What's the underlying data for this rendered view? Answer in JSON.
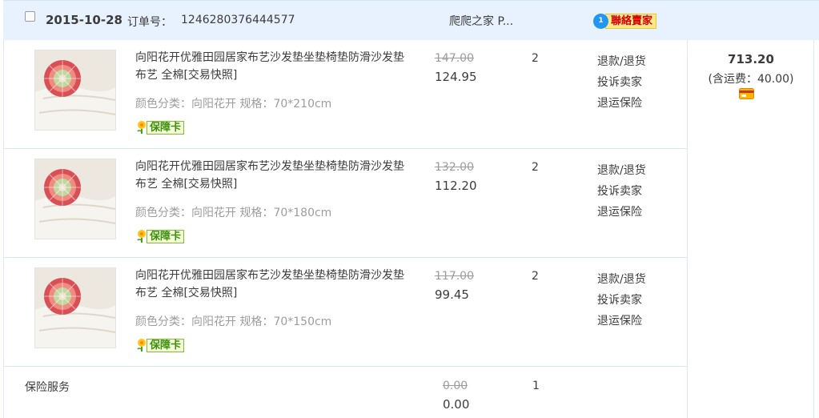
{
  "order": {
    "date": "2015-10-28",
    "order_no_label": "订单号：",
    "order_no": "1246280376444577",
    "shop_name": "爬爬之家 P...",
    "contact_label": "聯絡賣家",
    "contact_badge": "1"
  },
  "items": [
    {
      "title": "向阳花开优雅田园居家布艺沙发垫坐垫椅垫防滑沙发垫 布艺 全棉[交易快照]",
      "sku": "颜色分类：向阳花开  规格：70*210cm",
      "badge": "保障卡",
      "price_original": "147.00",
      "price_now": "124.95",
      "qty": "2",
      "actions": [
        "退款/退货",
        "投诉卖家",
        "退运保险"
      ]
    },
    {
      "title": "向阳花开优雅田园居家布艺沙发垫坐垫椅垫防滑沙发垫 布艺 全棉[交易快照]",
      "sku": "颜色分类：向阳花开  规格：70*180cm",
      "badge": "保障卡",
      "price_original": "132.00",
      "price_now": "112.20",
      "qty": "2",
      "actions": [
        "退款/退货",
        "投诉卖家",
        "退运保险"
      ]
    },
    {
      "title": "向阳花开优雅田园居家布艺沙发垫坐垫椅垫防滑沙发垫 布艺 全棉[交易快照]",
      "sku": "颜色分类：向阳花开  规格：70*150cm",
      "badge": "保障卡",
      "price_original": "117.00",
      "price_now": "99.45",
      "qty": "2",
      "actions": [
        "退款/退货",
        "投诉卖家",
        "退运保险"
      ]
    }
  ],
  "insurance": {
    "label": "保险服务",
    "price_original": "0.00",
    "price_now": "0.00",
    "qty": "1"
  },
  "total": {
    "amount": "713.20",
    "shipping": "(含运费：40.00)"
  },
  "icons": {
    "contact": "chat-bubble-icon",
    "badge": "flower-icon",
    "payment": "card-icon"
  },
  "colors": {
    "header_bg": "#e8f2ff",
    "border": "#dce8f5",
    "contact_text": "#d40000",
    "badge_green": "#3e8f10"
  }
}
